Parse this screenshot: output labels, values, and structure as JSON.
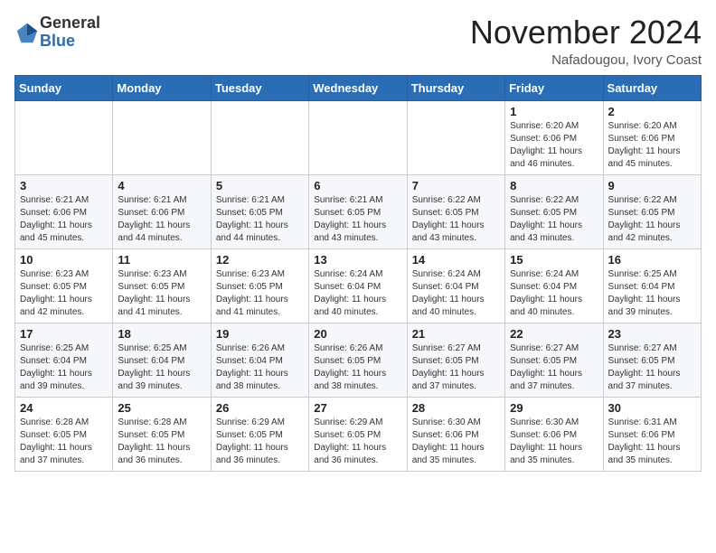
{
  "logo": {
    "general": "General",
    "blue": "Blue"
  },
  "title": "November 2024",
  "location": "Nafadougou, Ivory Coast",
  "weekdays": [
    "Sunday",
    "Monday",
    "Tuesday",
    "Wednesday",
    "Thursday",
    "Friday",
    "Saturday"
  ],
  "weeks": [
    [
      {
        "day": "",
        "info": ""
      },
      {
        "day": "",
        "info": ""
      },
      {
        "day": "",
        "info": ""
      },
      {
        "day": "",
        "info": ""
      },
      {
        "day": "",
        "info": ""
      },
      {
        "day": "1",
        "info": "Sunrise: 6:20 AM\nSunset: 6:06 PM\nDaylight: 11 hours\nand 46 minutes."
      },
      {
        "day": "2",
        "info": "Sunrise: 6:20 AM\nSunset: 6:06 PM\nDaylight: 11 hours\nand 45 minutes."
      }
    ],
    [
      {
        "day": "3",
        "info": "Sunrise: 6:21 AM\nSunset: 6:06 PM\nDaylight: 11 hours\nand 45 minutes."
      },
      {
        "day": "4",
        "info": "Sunrise: 6:21 AM\nSunset: 6:06 PM\nDaylight: 11 hours\nand 44 minutes."
      },
      {
        "day": "5",
        "info": "Sunrise: 6:21 AM\nSunset: 6:05 PM\nDaylight: 11 hours\nand 44 minutes."
      },
      {
        "day": "6",
        "info": "Sunrise: 6:21 AM\nSunset: 6:05 PM\nDaylight: 11 hours\nand 43 minutes."
      },
      {
        "day": "7",
        "info": "Sunrise: 6:22 AM\nSunset: 6:05 PM\nDaylight: 11 hours\nand 43 minutes."
      },
      {
        "day": "8",
        "info": "Sunrise: 6:22 AM\nSunset: 6:05 PM\nDaylight: 11 hours\nand 43 minutes."
      },
      {
        "day": "9",
        "info": "Sunrise: 6:22 AM\nSunset: 6:05 PM\nDaylight: 11 hours\nand 42 minutes."
      }
    ],
    [
      {
        "day": "10",
        "info": "Sunrise: 6:23 AM\nSunset: 6:05 PM\nDaylight: 11 hours\nand 42 minutes."
      },
      {
        "day": "11",
        "info": "Sunrise: 6:23 AM\nSunset: 6:05 PM\nDaylight: 11 hours\nand 41 minutes."
      },
      {
        "day": "12",
        "info": "Sunrise: 6:23 AM\nSunset: 6:05 PM\nDaylight: 11 hours\nand 41 minutes."
      },
      {
        "day": "13",
        "info": "Sunrise: 6:24 AM\nSunset: 6:04 PM\nDaylight: 11 hours\nand 40 minutes."
      },
      {
        "day": "14",
        "info": "Sunrise: 6:24 AM\nSunset: 6:04 PM\nDaylight: 11 hours\nand 40 minutes."
      },
      {
        "day": "15",
        "info": "Sunrise: 6:24 AM\nSunset: 6:04 PM\nDaylight: 11 hours\nand 40 minutes."
      },
      {
        "day": "16",
        "info": "Sunrise: 6:25 AM\nSunset: 6:04 PM\nDaylight: 11 hours\nand 39 minutes."
      }
    ],
    [
      {
        "day": "17",
        "info": "Sunrise: 6:25 AM\nSunset: 6:04 PM\nDaylight: 11 hours\nand 39 minutes."
      },
      {
        "day": "18",
        "info": "Sunrise: 6:25 AM\nSunset: 6:04 PM\nDaylight: 11 hours\nand 39 minutes."
      },
      {
        "day": "19",
        "info": "Sunrise: 6:26 AM\nSunset: 6:04 PM\nDaylight: 11 hours\nand 38 minutes."
      },
      {
        "day": "20",
        "info": "Sunrise: 6:26 AM\nSunset: 6:05 PM\nDaylight: 11 hours\nand 38 minutes."
      },
      {
        "day": "21",
        "info": "Sunrise: 6:27 AM\nSunset: 6:05 PM\nDaylight: 11 hours\nand 37 minutes."
      },
      {
        "day": "22",
        "info": "Sunrise: 6:27 AM\nSunset: 6:05 PM\nDaylight: 11 hours\nand 37 minutes."
      },
      {
        "day": "23",
        "info": "Sunrise: 6:27 AM\nSunset: 6:05 PM\nDaylight: 11 hours\nand 37 minutes."
      }
    ],
    [
      {
        "day": "24",
        "info": "Sunrise: 6:28 AM\nSunset: 6:05 PM\nDaylight: 11 hours\nand 37 minutes."
      },
      {
        "day": "25",
        "info": "Sunrise: 6:28 AM\nSunset: 6:05 PM\nDaylight: 11 hours\nand 36 minutes."
      },
      {
        "day": "26",
        "info": "Sunrise: 6:29 AM\nSunset: 6:05 PM\nDaylight: 11 hours\nand 36 minutes."
      },
      {
        "day": "27",
        "info": "Sunrise: 6:29 AM\nSunset: 6:05 PM\nDaylight: 11 hours\nand 36 minutes."
      },
      {
        "day": "28",
        "info": "Sunrise: 6:30 AM\nSunset: 6:06 PM\nDaylight: 11 hours\nand 35 minutes."
      },
      {
        "day": "29",
        "info": "Sunrise: 6:30 AM\nSunset: 6:06 PM\nDaylight: 11 hours\nand 35 minutes."
      },
      {
        "day": "30",
        "info": "Sunrise: 6:31 AM\nSunset: 6:06 PM\nDaylight: 11 hours\nand 35 minutes."
      }
    ]
  ]
}
